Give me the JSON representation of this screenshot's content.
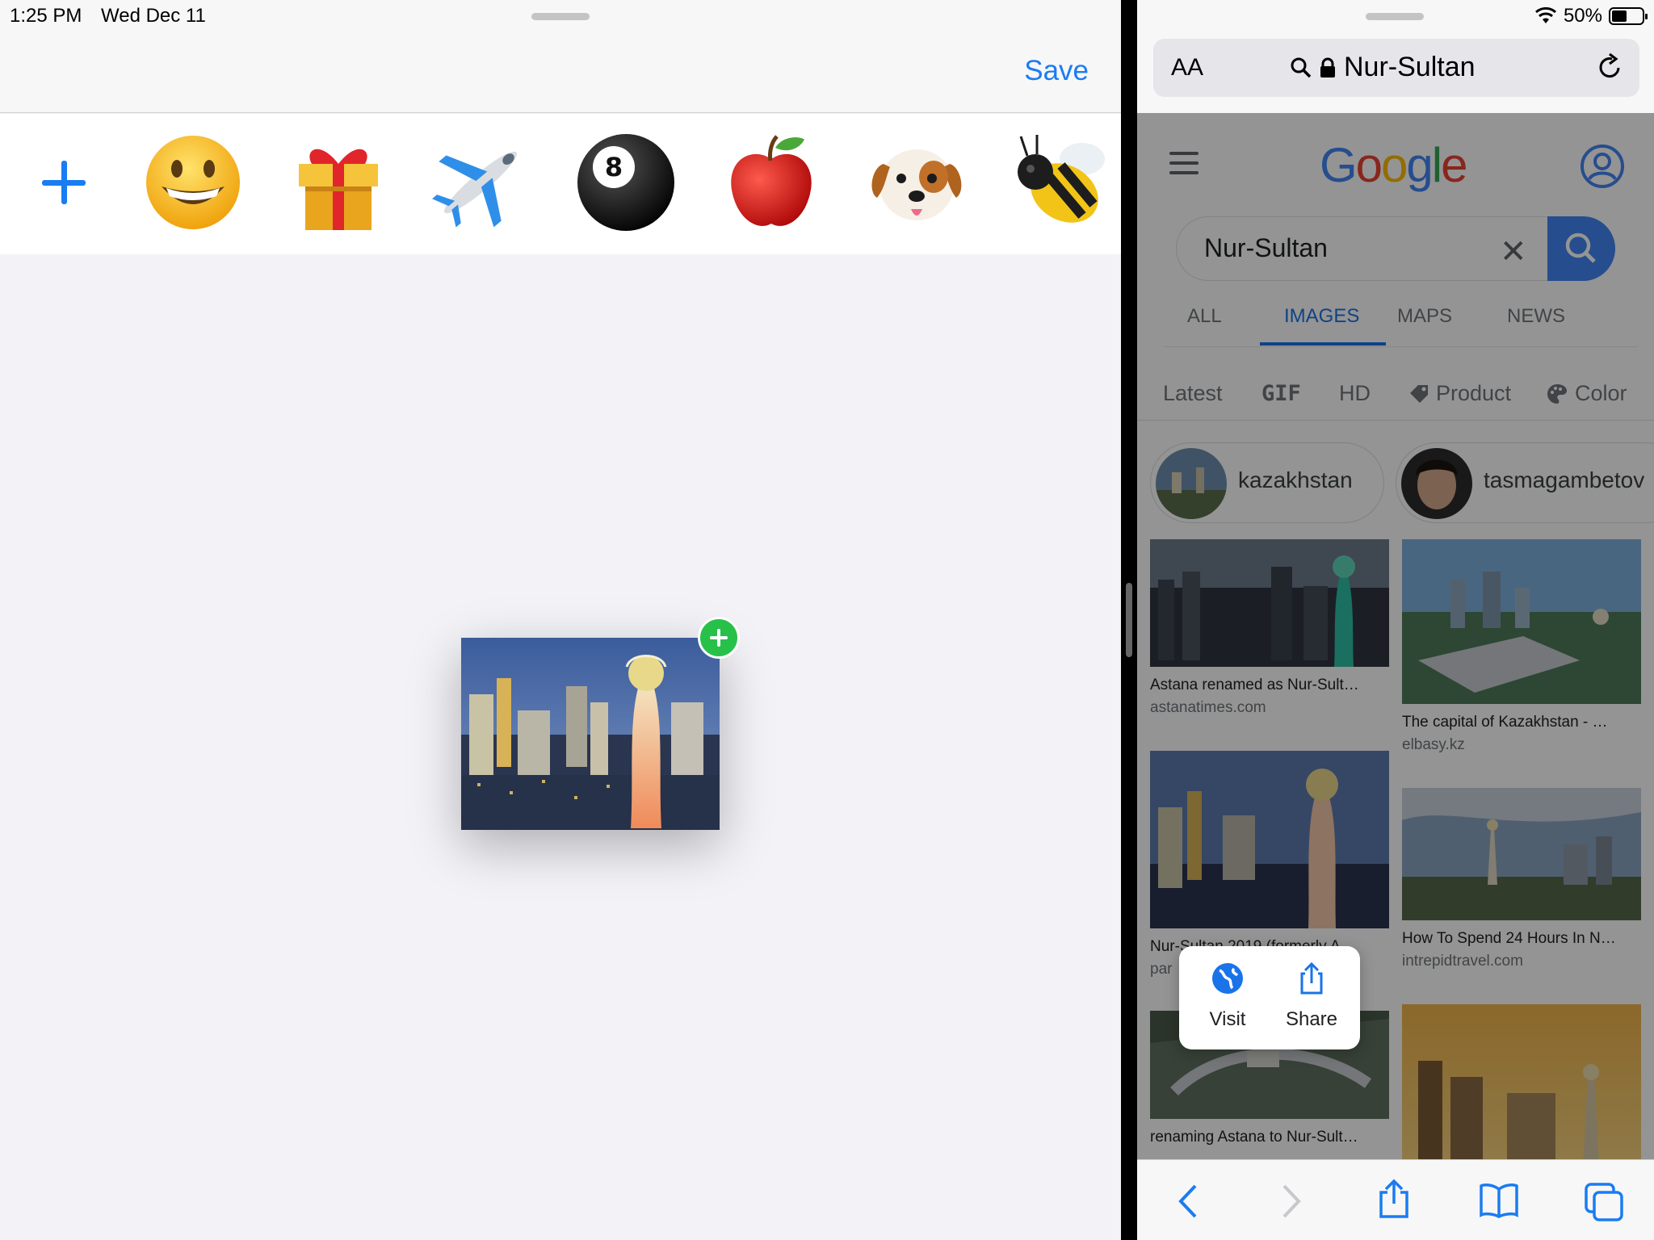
{
  "status": {
    "time": "1:25 PM",
    "date": "Wed Dec 11",
    "battery": "50%"
  },
  "left": {
    "save_label": "Save",
    "stickers": [
      {
        "icon": "grinning-face-icon"
      },
      {
        "icon": "gift-icon"
      },
      {
        "icon": "airplane-icon"
      },
      {
        "icon": "pool-8-ball-icon"
      },
      {
        "icon": "red-apple-icon"
      },
      {
        "icon": "dog-face-icon"
      },
      {
        "icon": "honeybee-icon"
      }
    ],
    "dragged_image": {
      "subject": "Bayterek tower at night"
    }
  },
  "safari": {
    "aa_label": "AA",
    "url": "Nur-Sultan",
    "toolbar": [
      "back-icon",
      "forward-icon",
      "share-icon",
      "bookmarks-icon",
      "tabs-icon"
    ]
  },
  "google": {
    "logo": "Google",
    "query": "Nur-Sultan",
    "tabs": [
      "ALL",
      "IMAGES",
      "MAPS",
      "NEWS"
    ],
    "active_tab": "IMAGES",
    "chips": [
      "Latest",
      "GIF",
      "HD",
      "Product",
      "Color"
    ],
    "entities": [
      "kazakhstan",
      "tasmagambetov"
    ],
    "results": [
      {
        "caption": "Astana renamed as Nur-Sult…",
        "source": "astanatimes.com"
      },
      {
        "caption": "The capital of Kazakhstan - …",
        "source": "elbasy.kz"
      },
      {
        "caption": "Nur-Sultan 2019 (formerly A…",
        "source": "par"
      },
      {
        "caption": "How To Spend 24 Hours In N…",
        "source": "intrepidtravel.com"
      },
      {
        "caption": "renaming Astana to Nur-Sult…",
        "source": ""
      }
    ],
    "popup": {
      "visit": "Visit",
      "share": "Share"
    }
  },
  "colors": {
    "ios_blue": "#1a7cf2",
    "google_blue": "#4285f4",
    "drop_green": "#27c14a"
  }
}
